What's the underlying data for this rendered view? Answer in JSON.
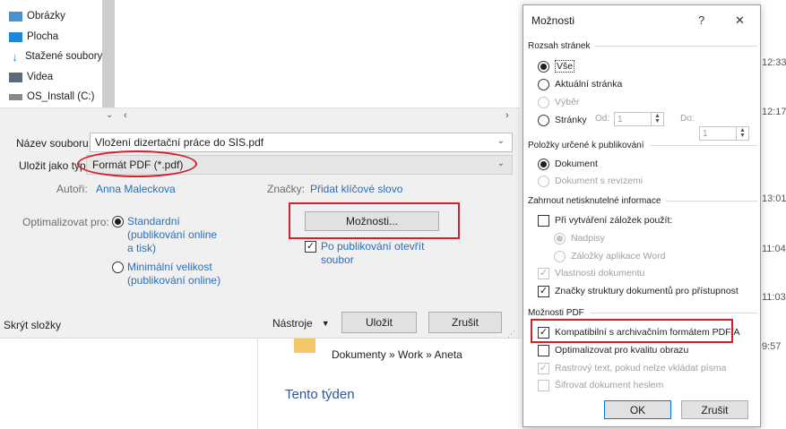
{
  "background": {
    "times": [
      "12:33",
      "12:17",
      "13:01",
      "11:04",
      "11:03",
      "9:57"
    ],
    "recent_path": "Dokumenty » Work » Aneta",
    "section_heading": "Tento týden"
  },
  "save_dialog": {
    "nav_items": [
      {
        "label": "Obrázky",
        "icon": "pictures-icon"
      },
      {
        "label": "Plocha",
        "icon": "desktop-icon"
      },
      {
        "label": "Stažené soubory",
        "icon": "downloads-icon"
      },
      {
        "label": "Videa",
        "icon": "videos-icon"
      },
      {
        "label": "OS_Install (C:)",
        "icon": "drive-icon"
      }
    ],
    "filename_label": "Název souboru:",
    "filename_value": "Vložení dizertační práce do SIS.pdf",
    "filetype_label": "Uložit jako typ:",
    "filetype_value": "Formát PDF (*.pdf)",
    "authors_label": "Autoři:",
    "authors_value": "Anna Maleckova",
    "tags_label": "Značky:",
    "tags_value": "Přidat klíčové slovo",
    "optimize_label": "Optimalizovat pro:",
    "optimize_standard": "Standardní (publikování online a tisk)",
    "optimize_minimal": "Minimální velikost (publikování online)",
    "options_button": "Možnosti...",
    "open_after_publish": "Po publikování otevřít soubor",
    "hide_folders": "Skrýt složky",
    "tools_label": "Nástroje",
    "save_button": "Uložit",
    "cancel_button": "Zrušit"
  },
  "options_dialog": {
    "title": "Možnosti",
    "help_glyph": "?",
    "close_glyph": "✕",
    "page_range": {
      "heading": "Rozsah stránek",
      "all": "Vše",
      "current": "Aktuální stránka",
      "selection": "Výběr",
      "pages": "Stránky",
      "from_label": "Od:",
      "from_value": "1",
      "to_label": "Do:",
      "to_value": "1"
    },
    "publish_what": {
      "heading": "Položky určené k publikování",
      "document": "Dokument",
      "document_markup": "Dokument s revizemi"
    },
    "nonprint": {
      "heading": "Zahrnout netisknutelné informace",
      "create_bookmarks": "Při vytváření záložek použít:",
      "headings": "Nadpisy",
      "word_bookmarks": "Záložky aplikace Word",
      "doc_properties": "Vlastnosti dokumentu",
      "struct_tags": "Značky struktury dokumentů pro přístupnost"
    },
    "pdf_options": {
      "heading": "Možnosti PDF",
      "pdfa": "Kompatibilní s archivačním formátem PDF/A",
      "optimize_image": "Optimalizovat pro kvalitu obrazu",
      "bitmap_text": "Rastrový text, pokud nelze vkládat písma",
      "encrypt": "Šifrovat dokument heslem"
    },
    "ok_button": "OK",
    "cancel_button": "Zrušit"
  },
  "colors": {
    "accent_red": "#d0202a",
    "link_blue": "#2a6ebb"
  }
}
